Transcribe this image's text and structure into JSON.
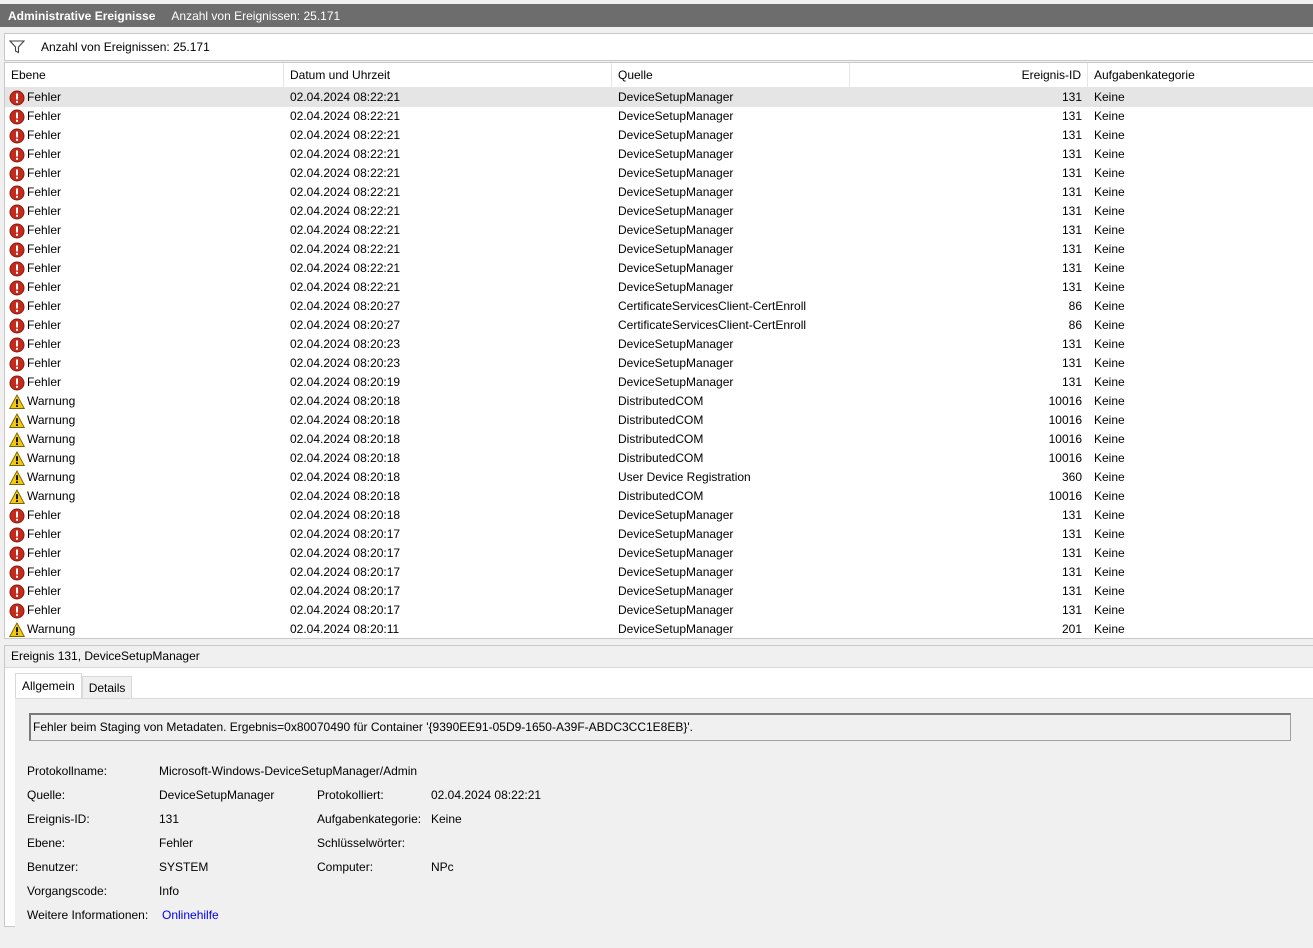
{
  "titlebar": {
    "title": "Administrative Ereignisse",
    "count": "Anzahl von Ereignissen: 25.171"
  },
  "filterbar": {
    "icon": "filter-icon",
    "text": "Anzahl von Ereignissen: 25.171"
  },
  "columns": [
    "Ebene",
    "Datum und Uhrzeit",
    "Quelle",
    "Ereignis-ID",
    "Aufgabenkategorie"
  ],
  "colors": {
    "error": "#c42b1c",
    "warning": "#f2c811",
    "selected": "#e5e5e5",
    "link": "#0000ee"
  },
  "rows": [
    {
      "level": "Fehler",
      "type": "error",
      "date": "02.04.2024 08:22:21",
      "source": "DeviceSetupManager",
      "id": "131",
      "cat": "Keine"
    },
    {
      "level": "Fehler",
      "type": "error",
      "date": "02.04.2024 08:22:21",
      "source": "DeviceSetupManager",
      "id": "131",
      "cat": "Keine"
    },
    {
      "level": "Fehler",
      "type": "error",
      "date": "02.04.2024 08:22:21",
      "source": "DeviceSetupManager",
      "id": "131",
      "cat": "Keine"
    },
    {
      "level": "Fehler",
      "type": "error",
      "date": "02.04.2024 08:22:21",
      "source": "DeviceSetupManager",
      "id": "131",
      "cat": "Keine"
    },
    {
      "level": "Fehler",
      "type": "error",
      "date": "02.04.2024 08:22:21",
      "source": "DeviceSetupManager",
      "id": "131",
      "cat": "Keine"
    },
    {
      "level": "Fehler",
      "type": "error",
      "date": "02.04.2024 08:22:21",
      "source": "DeviceSetupManager",
      "id": "131",
      "cat": "Keine"
    },
    {
      "level": "Fehler",
      "type": "error",
      "date": "02.04.2024 08:22:21",
      "source": "DeviceSetupManager",
      "id": "131",
      "cat": "Keine"
    },
    {
      "level": "Fehler",
      "type": "error",
      "date": "02.04.2024 08:22:21",
      "source": "DeviceSetupManager",
      "id": "131",
      "cat": "Keine"
    },
    {
      "level": "Fehler",
      "type": "error",
      "date": "02.04.2024 08:22:21",
      "source": "DeviceSetupManager",
      "id": "131",
      "cat": "Keine"
    },
    {
      "level": "Fehler",
      "type": "error",
      "date": "02.04.2024 08:22:21",
      "source": "DeviceSetupManager",
      "id": "131",
      "cat": "Keine"
    },
    {
      "level": "Fehler",
      "type": "error",
      "date": "02.04.2024 08:22:21",
      "source": "DeviceSetupManager",
      "id": "131",
      "cat": "Keine"
    },
    {
      "level": "Fehler",
      "type": "error",
      "date": "02.04.2024 08:20:27",
      "source": "CertificateServicesClient-CertEnroll",
      "id": "86",
      "cat": "Keine"
    },
    {
      "level": "Fehler",
      "type": "error",
      "date": "02.04.2024 08:20:27",
      "source": "CertificateServicesClient-CertEnroll",
      "id": "86",
      "cat": "Keine"
    },
    {
      "level": "Fehler",
      "type": "error",
      "date": "02.04.2024 08:20:23",
      "source": "DeviceSetupManager",
      "id": "131",
      "cat": "Keine"
    },
    {
      "level": "Fehler",
      "type": "error",
      "date": "02.04.2024 08:20:23",
      "source": "DeviceSetupManager",
      "id": "131",
      "cat": "Keine"
    },
    {
      "level": "Fehler",
      "type": "error",
      "date": "02.04.2024 08:20:19",
      "source": "DeviceSetupManager",
      "id": "131",
      "cat": "Keine"
    },
    {
      "level": "Warnung",
      "type": "warning",
      "date": "02.04.2024 08:20:18",
      "source": "DistributedCOM",
      "id": "10016",
      "cat": "Keine"
    },
    {
      "level": "Warnung",
      "type": "warning",
      "date": "02.04.2024 08:20:18",
      "source": "DistributedCOM",
      "id": "10016",
      "cat": "Keine"
    },
    {
      "level": "Warnung",
      "type": "warning",
      "date": "02.04.2024 08:20:18",
      "source": "DistributedCOM",
      "id": "10016",
      "cat": "Keine"
    },
    {
      "level": "Warnung",
      "type": "warning",
      "date": "02.04.2024 08:20:18",
      "source": "DistributedCOM",
      "id": "10016",
      "cat": "Keine"
    },
    {
      "level": "Warnung",
      "type": "warning",
      "date": "02.04.2024 08:20:18",
      "source": "User Device Registration",
      "id": "360",
      "cat": "Keine"
    },
    {
      "level": "Warnung",
      "type": "warning",
      "date": "02.04.2024 08:20:18",
      "source": "DistributedCOM",
      "id": "10016",
      "cat": "Keine"
    },
    {
      "level": "Fehler",
      "type": "error",
      "date": "02.04.2024 08:20:18",
      "source": "DeviceSetupManager",
      "id": "131",
      "cat": "Keine"
    },
    {
      "level": "Fehler",
      "type": "error",
      "date": "02.04.2024 08:20:17",
      "source": "DeviceSetupManager",
      "id": "131",
      "cat": "Keine"
    },
    {
      "level": "Fehler",
      "type": "error",
      "date": "02.04.2024 08:20:17",
      "source": "DeviceSetupManager",
      "id": "131",
      "cat": "Keine"
    },
    {
      "level": "Fehler",
      "type": "error",
      "date": "02.04.2024 08:20:17",
      "source": "DeviceSetupManager",
      "id": "131",
      "cat": "Keine"
    },
    {
      "level": "Fehler",
      "type": "error",
      "date": "02.04.2024 08:20:17",
      "source": "DeviceSetupManager",
      "id": "131",
      "cat": "Keine"
    },
    {
      "level": "Fehler",
      "type": "error",
      "date": "02.04.2024 08:20:17",
      "source": "DeviceSetupManager",
      "id": "131",
      "cat": "Keine"
    },
    {
      "level": "Warnung",
      "type": "warning",
      "date": "02.04.2024 08:20:11",
      "source": "DeviceSetupManager",
      "id": "201",
      "cat": "Keine"
    }
  ],
  "selected_row": 0,
  "detail": {
    "title": "Ereignis 131, DeviceSetupManager",
    "tabs": [
      "Allgemein",
      "Details"
    ],
    "active_tab": "Allgemein",
    "message": "Fehler beim Staging von Metadaten. Ergebnis=0x80070490 für Container '{9390EE91-05D9-1650-A39F-ABDC3CC1E8EB}'.",
    "protokollname_label": "Protokollname:",
    "protokollname": "Microsoft-Windows-DeviceSetupManager/Admin",
    "quelle_label": "Quelle:",
    "quelle": "DeviceSetupManager",
    "protokolliert_label": "Protokolliert:",
    "protokolliert": "02.04.2024 08:22:21",
    "ereignisid_label": "Ereignis-ID:",
    "ereignisid": "131",
    "aufgabenkategorie_label": "Aufgabenkategorie:",
    "aufgabenkategorie": "Keine",
    "ebene_label": "Ebene:",
    "ebene": "Fehler",
    "schluesselwoerter_label": "Schlüsselwörter:",
    "schluesselwoerter": "",
    "benutzer_label": "Benutzer:",
    "benutzer": "SYSTEM",
    "computer_label": "Computer:",
    "computer": "NPc",
    "vorgangscode_label": "Vorgangscode:",
    "vorgangscode": "Info",
    "weitere_label": "Weitere Informationen:",
    "weitere_link": "Onlinehilfe"
  }
}
